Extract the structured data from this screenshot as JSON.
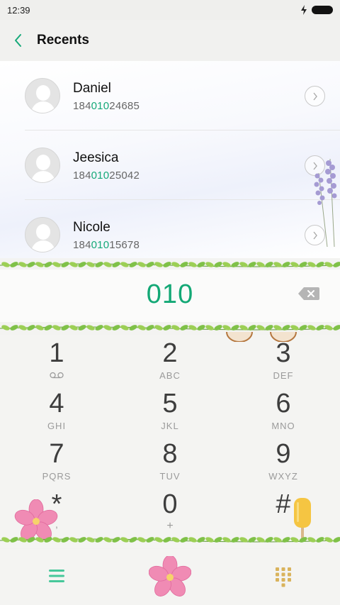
{
  "status_bar": {
    "time": "12:39"
  },
  "header": {
    "title": "Recents"
  },
  "recents": [
    {
      "name": "Daniel",
      "number_prefix": "184",
      "number_match": "010",
      "number_suffix": "24685"
    },
    {
      "name": "Jeesica",
      "number_prefix": "184",
      "number_match": "010",
      "number_suffix": "25042"
    },
    {
      "name": "Nicole",
      "number_prefix": "184",
      "number_match": "010",
      "number_suffix": "15678"
    }
  ],
  "dialer": {
    "input": "010"
  },
  "keypad": [
    {
      "digit": "1",
      "letters": "",
      "icon": "voicemail-icon"
    },
    {
      "digit": "2",
      "letters": "ABC"
    },
    {
      "digit": "3",
      "letters": "DEF"
    },
    {
      "digit": "4",
      "letters": "GHI"
    },
    {
      "digit": "5",
      "letters": "JKL"
    },
    {
      "digit": "6",
      "letters": "MNO"
    },
    {
      "digit": "7",
      "letters": "PQRS"
    },
    {
      "digit": "8",
      "letters": "TUV"
    },
    {
      "digit": "9",
      "letters": "WXYZ"
    },
    {
      "digit": "*",
      "letters": ","
    },
    {
      "digit": "0",
      "letters": "+"
    },
    {
      "digit": "#",
      "letters": ""
    }
  ],
  "colors": {
    "accent": "#16a979",
    "leaf": "#7fc148",
    "dialpad_icon": "#d9b35c"
  },
  "icons": {
    "back": "chevron-left-icon",
    "detail": "chevron-right-icon",
    "backspace": "backspace-icon",
    "menu": "menu-icon",
    "call": "flower-call-icon",
    "dialpad": "dialpad-icon"
  }
}
